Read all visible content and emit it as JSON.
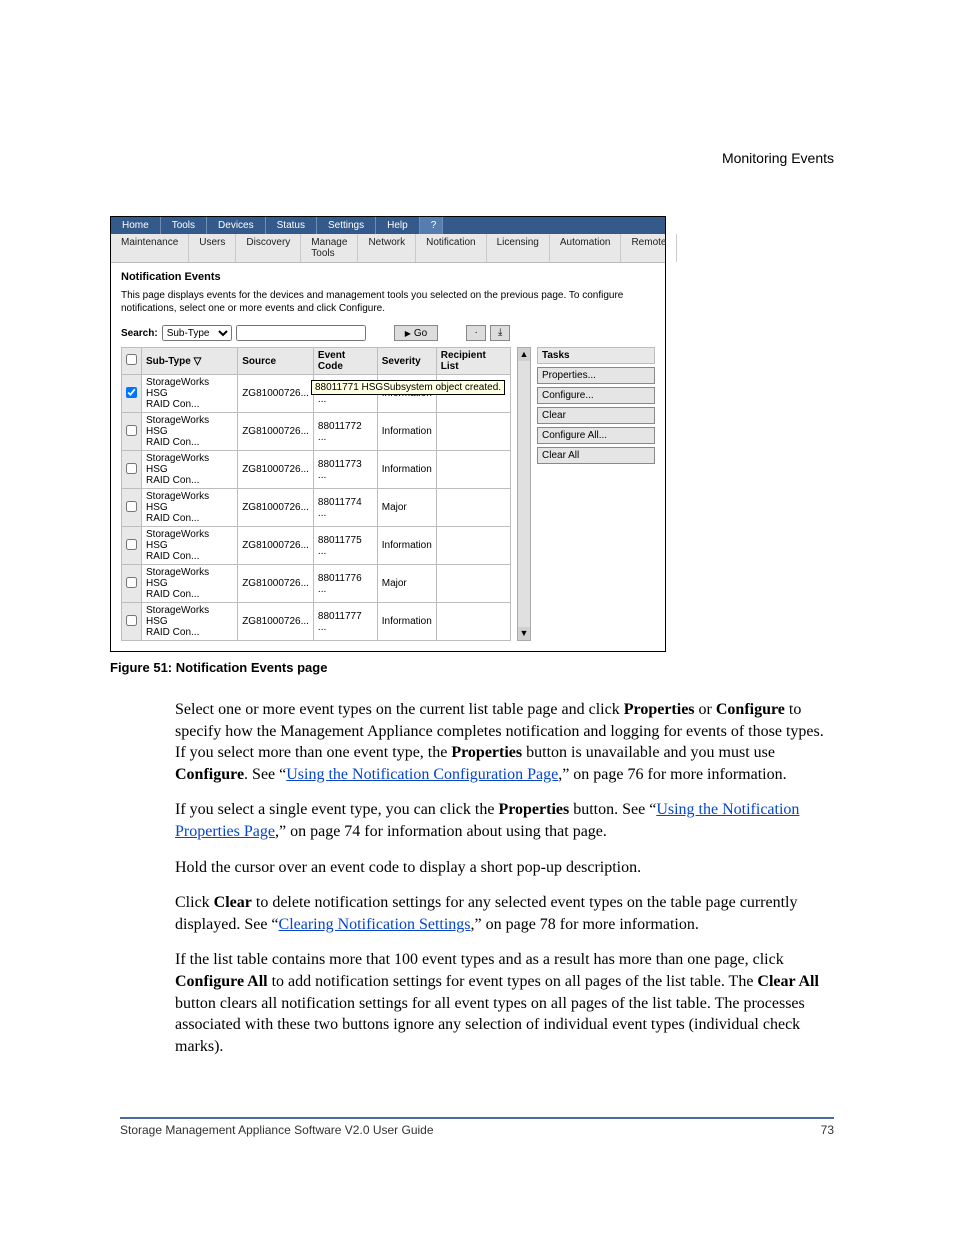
{
  "runningHead": "Monitoring Events",
  "menubar": [
    "Home",
    "Tools",
    "Devices",
    "Status",
    "Settings",
    "Help",
    "?"
  ],
  "submenu": [
    "Maintenance",
    "Users",
    "Discovery",
    "Manage Tools",
    "Network",
    "Notification",
    "Licensing",
    "Automation",
    "Remote"
  ],
  "panel": {
    "title": "Notification Events",
    "desc": "This page displays events for the devices and management tools you selected on the previous page. To configure notifications, select one or more events and click Configure.",
    "searchLabel": "Search:",
    "searchSel": "Sub-Type",
    "go": "Go"
  },
  "columns": [
    "",
    "Sub-Type ▽",
    "Source",
    "Event Code",
    "Severity",
    "Recipient List"
  ],
  "rows": [
    {
      "chk": true,
      "sub": "StorageWorks HSG RAID Con...",
      "src": "ZG81000726...",
      "code": "88011771 ...",
      "sev": "Information",
      "rcp": ""
    },
    {
      "chk": false,
      "sub": "StorageWorks HSG RAID Con...",
      "src": "ZG81000726...",
      "code": "88011772 ...",
      "sev": "Information",
      "rcp": ""
    },
    {
      "chk": false,
      "sub": "StorageWorks HSG RAID Con...",
      "src": "ZG81000726...",
      "code": "88011773 ...",
      "sev": "Information",
      "rcp": ""
    },
    {
      "chk": false,
      "sub": "StorageWorks HSG RAID Con...",
      "src": "ZG81000726...",
      "code": "88011774 ...",
      "sev": "Major",
      "rcp": ""
    },
    {
      "chk": false,
      "sub": "StorageWorks HSG RAID Con...",
      "src": "ZG81000726...",
      "code": "88011775 ...",
      "sev": "Information",
      "rcp": ""
    },
    {
      "chk": false,
      "sub": "StorageWorks HSG RAID Con...",
      "src": "ZG81000726...",
      "code": "88011776 ...",
      "sev": "Major",
      "rcp": ""
    },
    {
      "chk": false,
      "sub": "StorageWorks HSG RAID Con...",
      "src": "ZG81000726...",
      "code": "88011777 ...",
      "sev": "Information",
      "rcp": ""
    }
  ],
  "tooltip": "88011771  HSGSubsystem object created.",
  "tasks": {
    "header": "Tasks",
    "buttons": [
      "Properties...",
      "Configure...",
      "Clear",
      "Configure All...",
      "Clear All"
    ]
  },
  "caption": "Figure 51:  Notification Events page",
  "para1a": "Select one or more event types on the current list table page and click ",
  "b_properties": "Properties",
  "para1b": " or ",
  "b_configure": "Configure",
  "para1c": " to specify how the Management Appliance completes notification and logging for events of those types. If you select more than one event type, the ",
  "b_properties2": "Properties",
  "para1d": " button is unavailable and you must use ",
  "b_configure2": "Configure",
  "para1e": ". See “",
  "link1": "Using the Notification Configuration Page",
  "para1f": ",” on page 76 for more information.",
  "para2a": "If you select a single event type, you can click the ",
  "b_properties3": "Properties",
  "para2b": " button. See “",
  "link2": "Using the Notification Properties Page",
  "para2c": ",” on page 74 for information about using that page.",
  "para3": "Hold the cursor over an event code to display a short pop-up description.",
  "para4a": "Click ",
  "b_clear": "Clear",
  "para4b": " to delete notification settings for any selected event types on the table page currently displayed. See “",
  "link3": "Clearing Notification Settings",
  "para4c": ",” on page 78 for more information.",
  "para5a": "If the list table contains more that 100 event types and as a result has more than one page, click ",
  "b_cfgall": "Configure All",
  "para5b": " to add notification settings for event types on all pages of the list table. The ",
  "b_clearall": "Clear All",
  "para5c": " button clears all notification settings for all event types on all pages of the list table. The processes associated with these two buttons ignore any selection of individual event types (individual check marks).",
  "footerLeft": "Storage Management Appliance Software V2.0 User Guide",
  "footerRight": "73"
}
